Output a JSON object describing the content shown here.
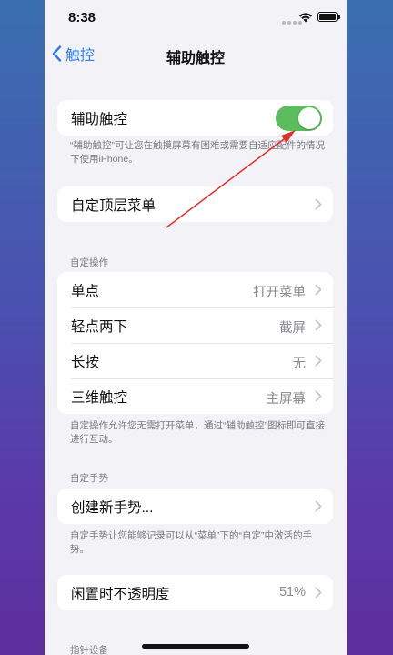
{
  "status_bar": {
    "time": "8:38"
  },
  "nav": {
    "back_label": "触控",
    "title": "辅助触控"
  },
  "main_toggle": {
    "label": "辅助触控",
    "on": true,
    "on_color": "#5bbd5e"
  },
  "main_toggle_footnote": "“辅助触控”可让您在触摸屏幕有困难或需要自适应配件的情况下使用iPhone。",
  "customize_menu": {
    "label": "自定顶层菜单"
  },
  "custom_actions": {
    "header": "自定操作",
    "rows": [
      {
        "label": "单点",
        "value": "打开菜单"
      },
      {
        "label": "轻点两下",
        "value": "截屏"
      },
      {
        "label": "长按",
        "value": "无"
      },
      {
        "label": "三维触控",
        "value": "主屏幕"
      }
    ],
    "footnote": "自定操作允许您无需打开菜单，通过“辅助触控”图标即可直接进行互动。"
  },
  "custom_gestures": {
    "header": "自定手势",
    "create_label": "创建新手势...",
    "footnote": "自定手势让您能够记录可以从“菜单”下的“自定”中激活的手势。"
  },
  "idle_opacity": {
    "label": "闲置时不透明度",
    "value": "51%"
  },
  "pointer_devices": {
    "header": "指针设备"
  },
  "colors": {
    "accent_blue": "#2f7cf6",
    "annotation_red": "#e0322c"
  }
}
